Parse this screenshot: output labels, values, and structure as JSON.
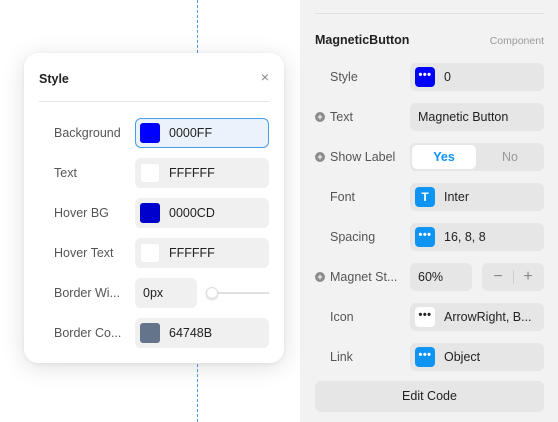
{
  "canvas": {},
  "panel": {
    "component_name": "MagneticButton",
    "component_type": "Component",
    "rows": {
      "style": {
        "label": "Style",
        "value": "0",
        "badge_icon": "dots-icon"
      },
      "text": {
        "label": "Text",
        "value": "Magnetic Button"
      },
      "show_label": {
        "label": "Show Label",
        "yes": "Yes",
        "no": "No",
        "selected": "Yes"
      },
      "font": {
        "label": "Font",
        "value": "Inter",
        "badge_icon": "T"
      },
      "spacing": {
        "label": "Spacing",
        "value": "16, 8, 8",
        "badge_icon": "dots-icon"
      },
      "magnet": {
        "label": "Magnet St...",
        "value": "60%",
        "minus": "−",
        "plus": "+"
      },
      "icon": {
        "label": "Icon",
        "value": "ArrowRight, B...",
        "badge_icon": "dots-icon"
      },
      "link": {
        "label": "Link",
        "value": "Object",
        "badge_icon": "dots-icon"
      }
    },
    "edit_code": "Edit Code"
  },
  "popup": {
    "title": "Style",
    "close": "×",
    "rows": {
      "background": {
        "label": "Background",
        "value": "0000FF",
        "color": "#0000ff"
      },
      "text": {
        "label": "Text",
        "value": "FFFFFF",
        "color": "#ffffff"
      },
      "hover_bg": {
        "label": "Hover BG",
        "value": "0000CD",
        "color": "#0000cd"
      },
      "hover_text": {
        "label": "Hover Text",
        "value": "FFFFFF",
        "color": "#ffffff"
      },
      "border_width": {
        "label": "Border Wi...",
        "value": "0px",
        "slider_level": 0
      },
      "border_color": {
        "label": "Border Co...",
        "value": "64748B",
        "color": "#64748b"
      }
    }
  },
  "colors": {
    "accent": "#1094f4",
    "guide": "#4a9be8",
    "panel_bg": "#f2f2f2"
  }
}
